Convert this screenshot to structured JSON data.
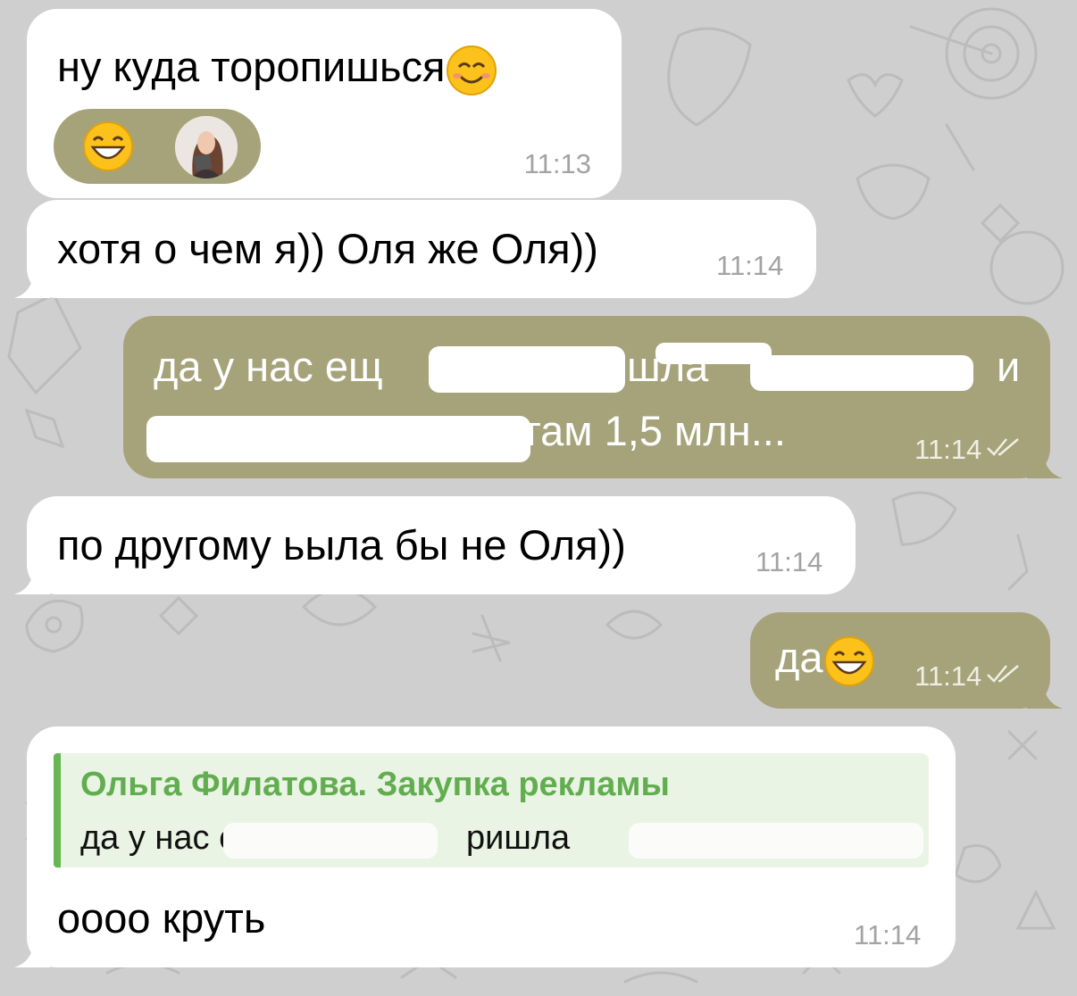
{
  "messages": [
    {
      "sender": "incoming",
      "text": "ну куда торопишься",
      "emoji": "smiling-face-emoji",
      "time": "11:13",
      "reaction": {
        "emoji": "grinning-face-emoji"
      }
    },
    {
      "sender": "incoming",
      "text": "хотя о чем я)) Оля же Оля))",
      "time": "11:14"
    },
    {
      "sender": "outgoing",
      "line1_start": "да у нас ещ",
      "line1_mid": "шла",
      "line1_end": "и",
      "line2": ", там 1,5 млн...",
      "time": "11:14",
      "status": "read"
    },
    {
      "sender": "incoming",
      "text": "по другому ьыла бы не Оля))",
      "time": "11:14"
    },
    {
      "sender": "outgoing",
      "text": "да",
      "emoji": "grinning-face-emoji",
      "time": "11:14",
      "status": "read"
    },
    {
      "sender": "incoming",
      "reply_name": "Ольга Филатова. Закупка рекламы",
      "reply_text_start": "да у нас є",
      "reply_text_mid": "ришла",
      "text": "оооо круть",
      "time": "11:14"
    }
  ],
  "colors": {
    "outgoing_bubble": "#a6a37a",
    "incoming_bubble": "#ffffff",
    "reply_accent": "#62ad50",
    "background": "#cfcfcf"
  }
}
